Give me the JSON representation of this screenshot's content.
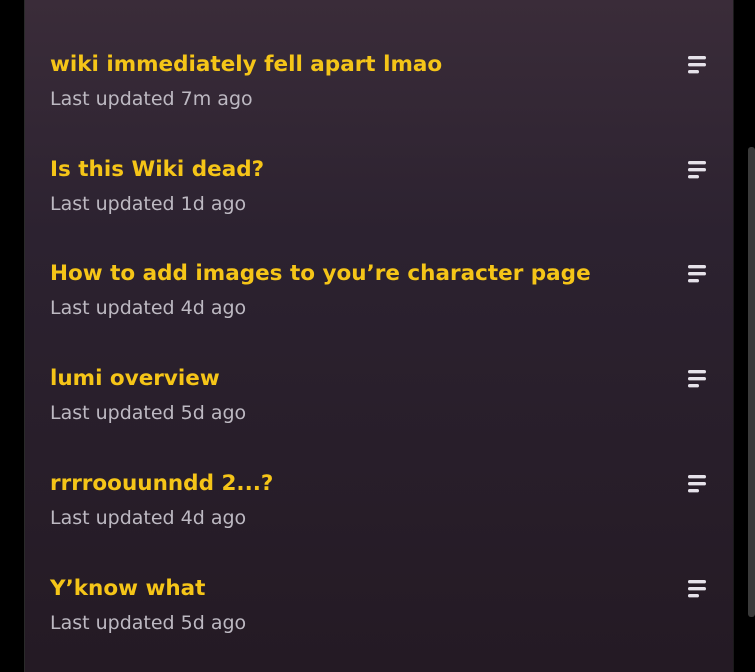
{
  "threads": [
    {
      "title": "wiki immediately fell apart lmao",
      "updated": "Last updated 7m ago",
      "menu_icon": "menu-lines-icon"
    },
    {
      "title": "Is this Wiki dead?",
      "updated": "Last updated 1d ago",
      "menu_icon": "menu-lines-icon"
    },
    {
      "title": "How to add images to you’re character page",
      "updated": "Last updated 4d ago",
      "menu_icon": "menu-lines-icon"
    },
    {
      "title": "lumi overview",
      "updated": "Last updated 5d ago",
      "menu_icon": "menu-lines-icon"
    },
    {
      "title": "rrrroouunndd 2...?",
      "updated": "Last updated 4d ago",
      "menu_icon": "menu-lines-icon"
    },
    {
      "title": "Y’know what",
      "updated": "Last updated 5d ago",
      "menu_icon": "menu-lines-icon"
    }
  ],
  "colors": {
    "title": "#f5c518",
    "meta": "#bdb9c2",
    "background": "#2c2230",
    "icon": "#e6e2ea"
  }
}
